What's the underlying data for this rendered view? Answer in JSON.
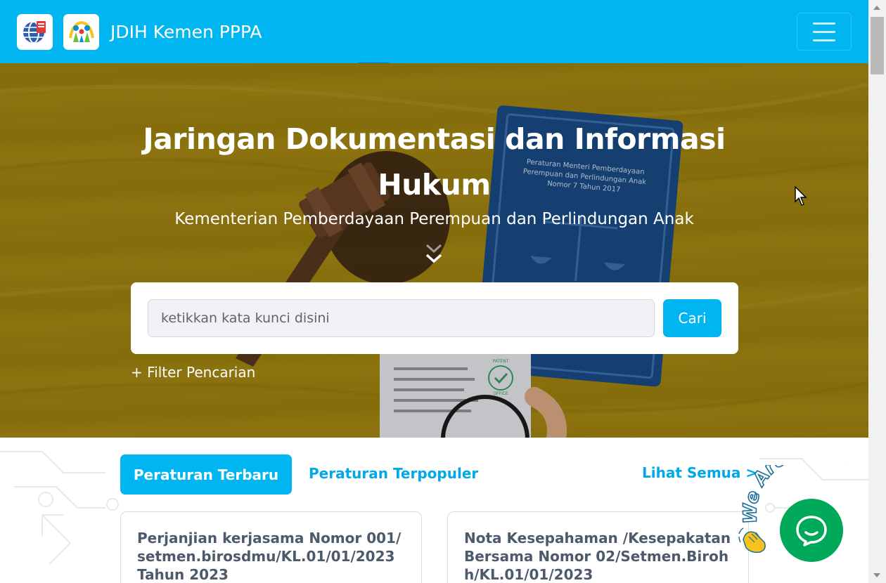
{
  "navbar": {
    "title": "JDIH Kemen PPPA",
    "logos": [
      "jdih-globe-logo",
      "kemenpppa-logo"
    ],
    "menu_icon": "hamburger-icon",
    "background_color": "#00b5f0"
  },
  "hero": {
    "title": "Jaringan Dokumentasi dan Informasi Hukum",
    "subtitle": "Kementerian Pemberdayaan Perempuan dan Perlindungan Anak",
    "scroll_icon": "double-chevron-down-icon",
    "book_text": "Peraturan Menteri Pemberdayaan Perempuan dan Perlindungan Anak Nomor 7 Tahun 2017",
    "stamp_text": "PATENT OFFICE"
  },
  "search": {
    "placeholder": "ketikkan kata kunci disini",
    "button_label": "Cari",
    "filter_label": "+ Filter Pencarian"
  },
  "content": {
    "tabs": [
      {
        "label": "Peraturan Terbaru",
        "active": true
      },
      {
        "label": "Peraturan Terpopuler",
        "active": false
      }
    ],
    "see_all": "Lihat Semua >",
    "cards": [
      {
        "title": "Perjanjian kerjasama Nomor 001/setmen.birosdmu/KL.01/01/2023 Tahun 2023"
      },
      {
        "title": "Nota Kesepahaman /Kesepakatan Bersama Nomor 02/Setmen.Birohh/KL.01/01/2023"
      }
    ]
  },
  "chat": {
    "label": "We Are Here!",
    "icon": "chat-bubble-icon",
    "accent_color": "#00a85a"
  },
  "accent_color": "#00b5f0"
}
